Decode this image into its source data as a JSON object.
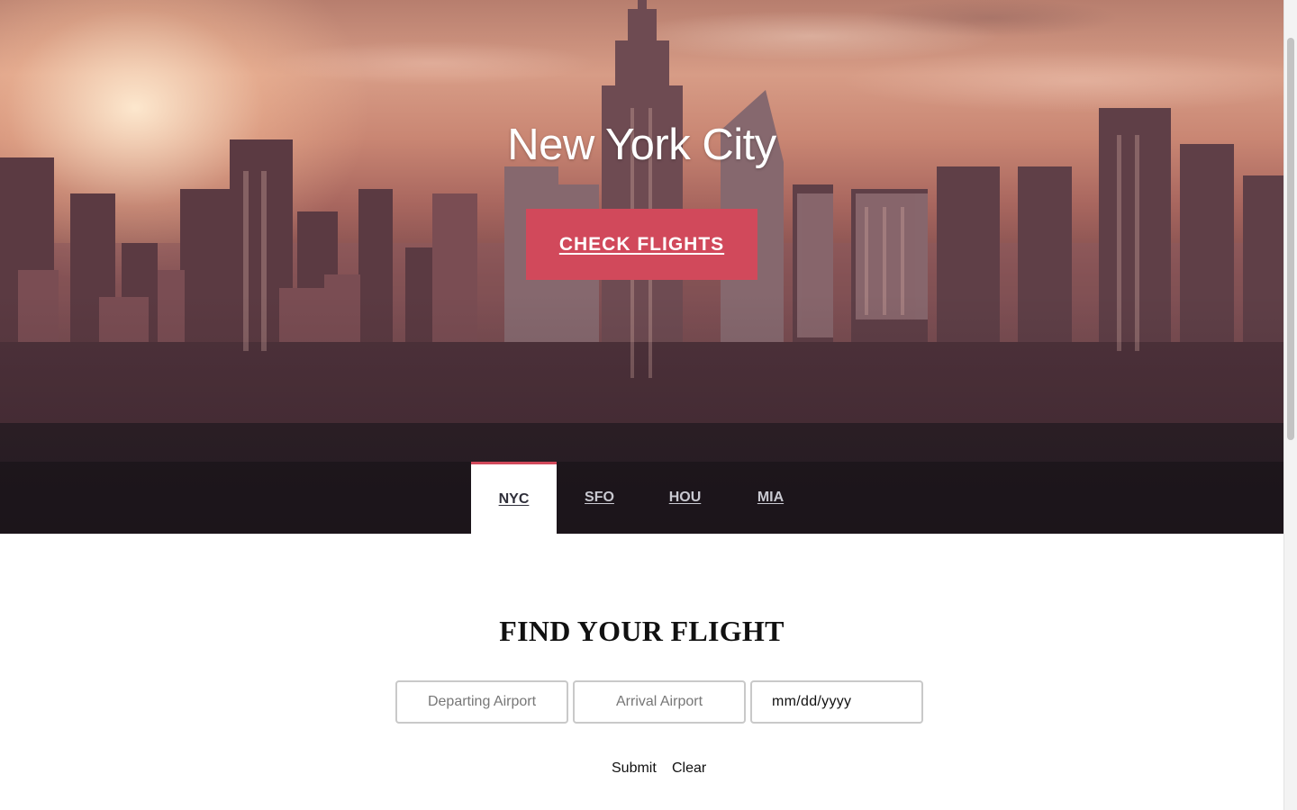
{
  "hero": {
    "title": "New York City",
    "cta_label": "CHECK FLIGHTS"
  },
  "tabs": [
    {
      "label": "NYC",
      "active": true
    },
    {
      "label": "SFO",
      "active": false
    },
    {
      "label": "HOU",
      "active": false
    },
    {
      "label": "MIA",
      "active": false
    }
  ],
  "search": {
    "title": "FIND YOUR FLIGHT",
    "departing_placeholder": "Departing Airport",
    "arrival_placeholder": "Arrival Airport",
    "date_value": "mm/dd/yyyy",
    "submit_label": "Submit",
    "clear_label": "Clear"
  },
  "colors": {
    "accent": "#d1495b",
    "tab_bar": "#141016",
    "text_dark": "#111111"
  }
}
